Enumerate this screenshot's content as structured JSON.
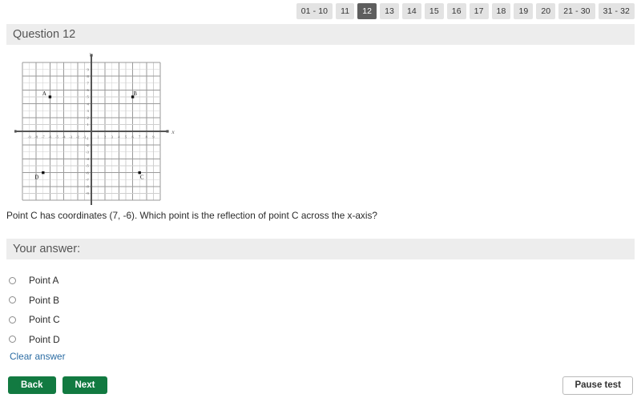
{
  "nav": {
    "chips": [
      {
        "label": "01 - 10",
        "current": false
      },
      {
        "label": "11",
        "current": false
      },
      {
        "label": "12",
        "current": true
      },
      {
        "label": "13",
        "current": false
      },
      {
        "label": "14",
        "current": false
      },
      {
        "label": "15",
        "current": false
      },
      {
        "label": "16",
        "current": false
      },
      {
        "label": "17",
        "current": false
      },
      {
        "label": "18",
        "current": false
      },
      {
        "label": "19",
        "current": false
      },
      {
        "label": "20",
        "current": false
      },
      {
        "label": "21 - 30",
        "current": false
      },
      {
        "label": "31 - 32",
        "current": false
      }
    ]
  },
  "header": {
    "title": "Question 12"
  },
  "question": {
    "text": "Point C has coordinates (7, -6). Which point is the reflection of point C across the x-axis?"
  },
  "answer": {
    "label": "Your answer:",
    "options": [
      {
        "label": "Point A",
        "selected": false
      },
      {
        "label": "Point B",
        "selected": false
      },
      {
        "label": "Point C",
        "selected": false
      },
      {
        "label": "Point D",
        "selected": false
      }
    ],
    "clear_label": "Clear answer"
  },
  "footer": {
    "back_label": "Back",
    "next_label": "Next",
    "pause_label": "Pause test"
  },
  "colors": {
    "accent_green": "#127a41",
    "link_blue": "#2b6ca3",
    "chip_bg": "#e3e3e3",
    "chip_current_bg": "#5e5e5e",
    "bar_bg": "#ededed"
  },
  "chart_data": {
    "type": "scatter",
    "title": "",
    "xlabel": "x",
    "ylabel": "y",
    "xlim": [
      -10,
      10
    ],
    "ylim": [
      -10,
      10
    ],
    "grid": true,
    "minor_grid_step": 1,
    "major_grid_step": 2,
    "xticks": [
      -9,
      -8,
      -7,
      -6,
      -5,
      -4,
      -3,
      -2,
      -1,
      1,
      2,
      3,
      4,
      5,
      6,
      7,
      8,
      9
    ],
    "yticks": [
      -9,
      -8,
      -7,
      -6,
      -5,
      -4,
      -3,
      -2,
      -1,
      1,
      2,
      3,
      4,
      5,
      6,
      7,
      8,
      9
    ],
    "xtick_labels": [
      "-9",
      "-8",
      "-7",
      "-6",
      "-5",
      "-4",
      "-3",
      "-2",
      "-1",
      "1",
      "2",
      "3",
      "4",
      "5",
      "6",
      "7",
      "8",
      "9"
    ],
    "ytick_labels": [
      "-9",
      "-8",
      "-7",
      "-6",
      "-5",
      "-4",
      "-3",
      "-2",
      "-1",
      "1",
      "2",
      "3",
      "4",
      "5",
      "6",
      "7",
      "8",
      "9"
    ],
    "points": [
      {
        "label": "A",
        "x": -6,
        "y": 5,
        "label_dx": -7,
        "label_dy": -2
      },
      {
        "label": "B",
        "x": 6,
        "y": 5,
        "label_dx": 3,
        "label_dy": -2
      },
      {
        "label": "C",
        "x": 7,
        "y": -6,
        "label_dx": 3,
        "label_dy": 8
      },
      {
        "label": "D",
        "x": -7,
        "y": -6,
        "label_dx": -8,
        "label_dy": 8
      }
    ]
  }
}
